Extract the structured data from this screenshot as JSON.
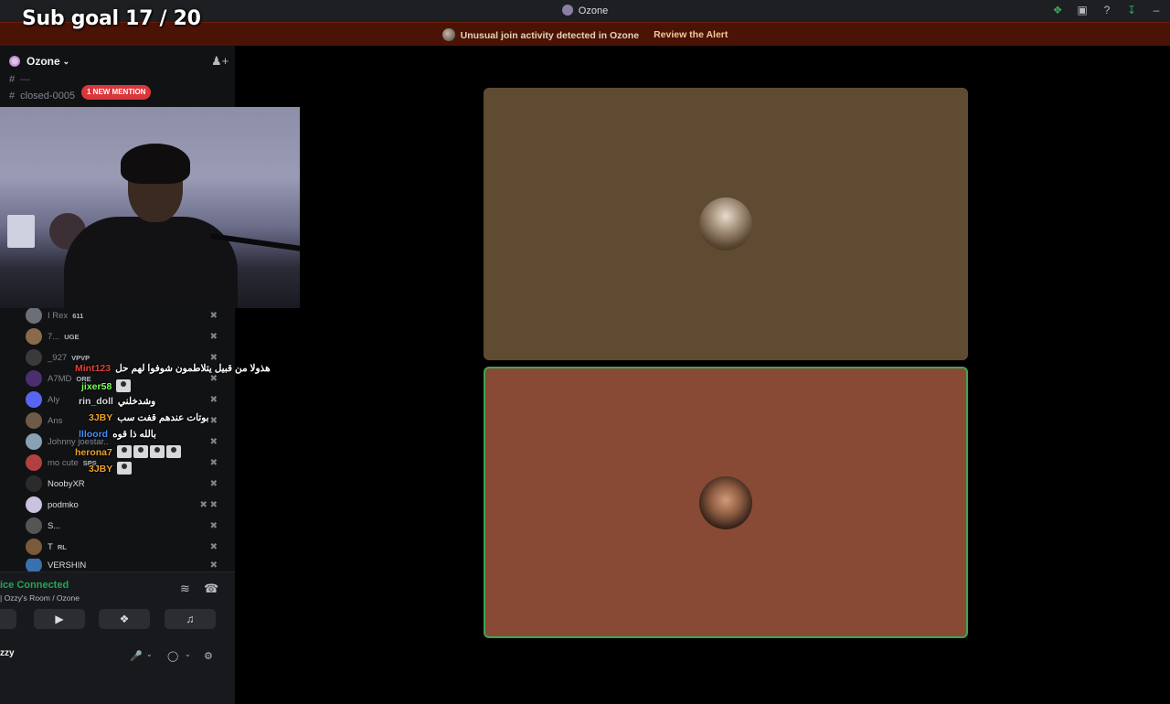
{
  "overlay": {
    "subgoal": "Sub goal 17 / 20"
  },
  "titlebar": {
    "title": "Ozone"
  },
  "alert": {
    "message": "Unusual join activity detected in Ozone",
    "action": "Review the Alert"
  },
  "sidebar": {
    "server_name": "Ozone",
    "channels": [
      {
        "name": "closed-0005"
      }
    ],
    "mention_pill": "1 NEW MENTION",
    "members": [
      {
        "name": "I Rex",
        "tag": "611",
        "color": "#6b6f78"
      },
      {
        "name": "7...",
        "tag": "UGE",
        "color": "#8a6a4a"
      },
      {
        "name": "_927",
        "tag": "VPVP",
        "color": "#3a3a3a"
      },
      {
        "name": "A7MD",
        "tag": "ORE",
        "color": "#4a2e6e"
      },
      {
        "name": "Aly",
        "tag": "",
        "color": "#5865f2"
      },
      {
        "name": "Ans",
        "tag": "",
        "color": "#6e5a48"
      },
      {
        "name": "Johnny joestar..",
        "tag": "",
        "color": "#8aa0b4"
      },
      {
        "name": "mo cute",
        "tag": "SPS",
        "color": "#b34040"
      },
      {
        "name": "NoobyXR",
        "tag": "",
        "color": "#2b2b2b"
      },
      {
        "name": "podmko",
        "tag": "",
        "color": "#c9c3e0"
      },
      {
        "name": "S...",
        "tag": "",
        "color": "#555"
      },
      {
        "name": "T",
        "tag": "RL",
        "color": "#7a5a3a"
      },
      {
        "name": "VERSHIN",
        "tag": "",
        "color": "#3c6fb0"
      }
    ]
  },
  "chat": [
    {
      "nick": "Mint123",
      "color": "#e0413c",
      "text": "هذولا من قبيل يتلاطمون شوفوا لهم حل"
    },
    {
      "nick": "jixer58",
      "color": "#7cfc5a",
      "text": ""
    },
    {
      "nick": "rin_doll",
      "color": "#d6d8dc",
      "text": "وشدخلني"
    },
    {
      "nick": "3JBY",
      "color": "#f0a028",
      "text": "بوتات عندهم قفت سب"
    },
    {
      "nick": "llloord",
      "color": "#4a8cf0",
      "text": "بالله ذا قوه"
    },
    {
      "nick": "herona7",
      "color": "#f0a028",
      "text": ""
    },
    {
      "nick": "3JBY",
      "color": "#f0a028",
      "text": ""
    }
  ],
  "voice": {
    "status": "ice Connected",
    "room": "| Ozzy's Room / Ozone",
    "user": "zzy"
  },
  "tiles": [
    {
      "name": "participant-1",
      "color": "#5f4b32"
    },
    {
      "name": "participant-2",
      "color": "#884a35"
    }
  ]
}
